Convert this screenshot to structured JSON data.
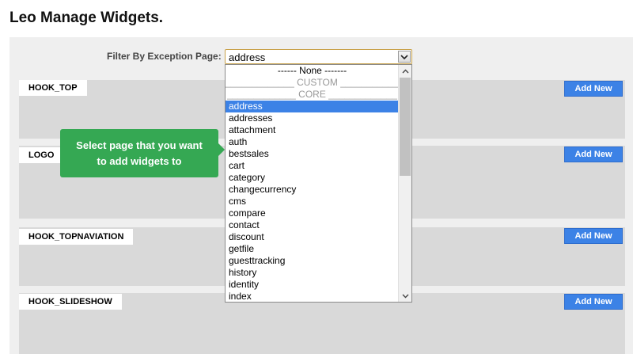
{
  "page": {
    "title": "Leo Manage Widgets."
  },
  "filter": {
    "label": "Filter By Exception Page:",
    "selected_value": "address"
  },
  "tooltip": {
    "line1": "Select page that you want",
    "line2": "to add widgets to"
  },
  "hooks": [
    {
      "label": "HOOK_TOP",
      "add_label": "Add New"
    },
    {
      "label": "LOGO",
      "add_label": "Add New"
    },
    {
      "label": "HOOK_TOPNAVIATION",
      "add_label": "Add New"
    },
    {
      "label": "HOOK_SLIDESHOW",
      "add_label": "Add New"
    }
  ],
  "dropdown": {
    "options": [
      "------ None -------",
      "_____________ CUSTOM _____________",
      "_____________ CORE _____________",
      "address",
      "addresses",
      "attachment",
      "auth",
      "bestsales",
      "cart",
      "category",
      "changecurrency",
      "cms",
      "compare",
      "contact",
      "discount",
      "getfile",
      "guesttracking",
      "history",
      "identity",
      "index"
    ],
    "selected_option": "address",
    "scroll_position": 0.0
  },
  "icons": {
    "select_arrow": "chevron-down-icon",
    "scroll_up": "chevron-up-icon",
    "scroll_down": "chevron-down-icon"
  },
  "colors": {
    "add_button": "#3c82e6",
    "tooltip": "#35a853",
    "selected_option": "#3c82e6",
    "hook_background": "#d9d9d9"
  }
}
